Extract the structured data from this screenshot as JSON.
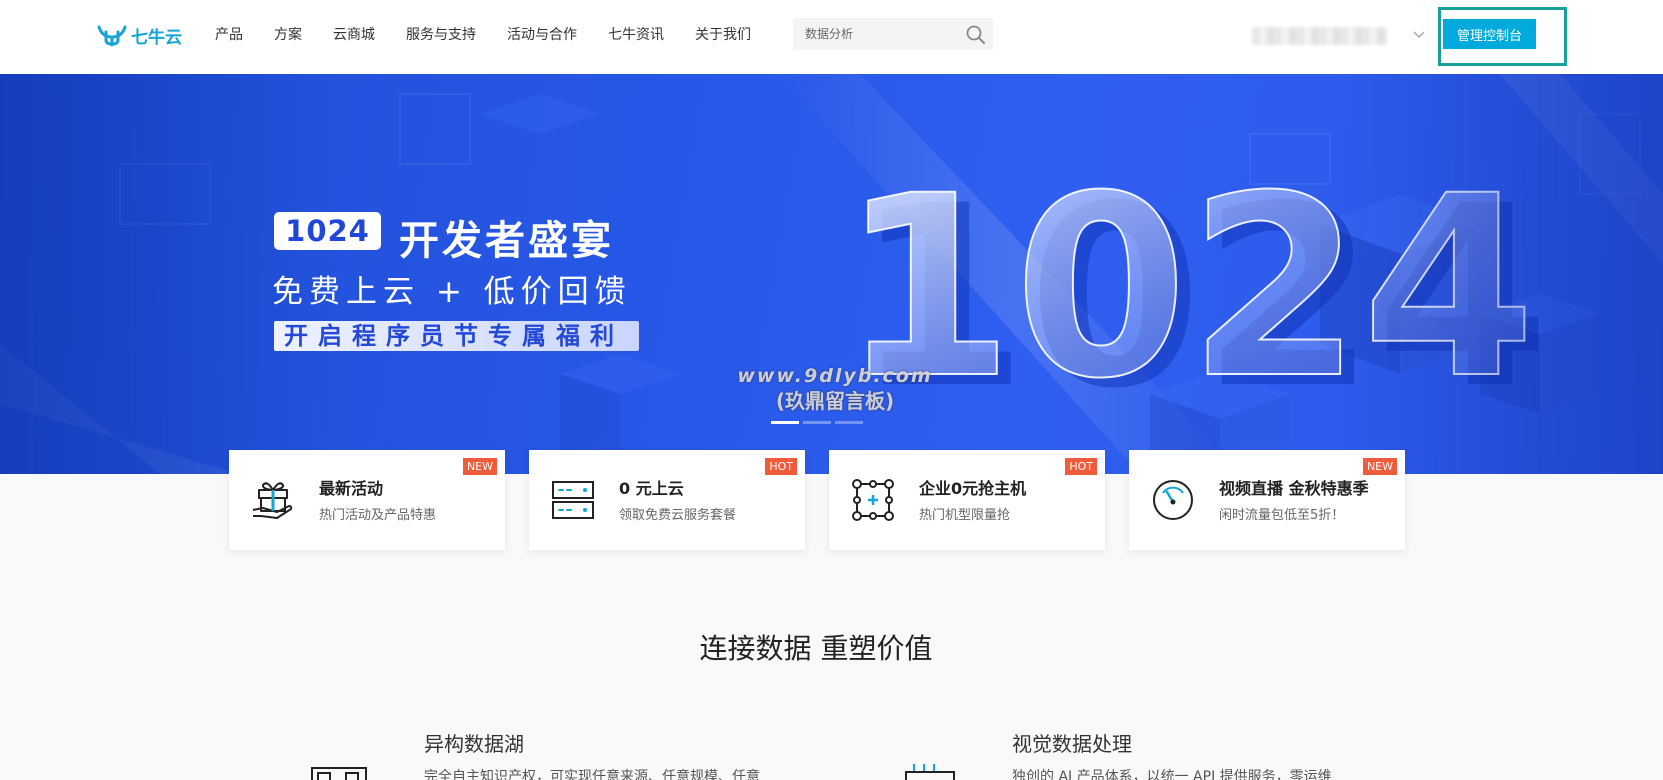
{
  "header": {
    "logo_text": "七牛云",
    "nav": [
      {
        "label": "产品"
      },
      {
        "label": "方案"
      },
      {
        "label": "云商城"
      },
      {
        "label": "服务与支持"
      },
      {
        "label": "活动与合作"
      },
      {
        "label": "七牛资讯"
      },
      {
        "label": "关于我们"
      }
    ],
    "search": {
      "placeholder": "数据分析"
    },
    "console_label": "管理控制台"
  },
  "banner": {
    "tag": "1024",
    "title": "开发者盛宴",
    "subtitle": "免费上云 + 低价回馈",
    "strip": "开启程序员节专属福利",
    "big_number": "1024",
    "watermark_line1": "www.9dlyb.com",
    "watermark_line2": "(玖鼎留言板)",
    "slide_count": 3,
    "active_slide": 1
  },
  "cards": [
    {
      "title": "最新活动",
      "desc": "热门活动及产品特惠",
      "badge": "NEW",
      "icon": "gift-icon"
    },
    {
      "title": "0 元上云",
      "desc": "领取免费云服务套餐",
      "badge": "HOT",
      "icon": "server-icon"
    },
    {
      "title": "企业0元抢主机",
      "desc": "热门机型限量抢",
      "badge": "HOT",
      "icon": "host-node-icon"
    },
    {
      "title": "视频直播 金秋特惠季",
      "desc": "闲时流量包低至5折！",
      "badge": "NEW",
      "icon": "speed-gauge-icon"
    }
  ],
  "section": {
    "title": "连接数据 重塑价值",
    "features": [
      {
        "title": "异构数据湖",
        "desc": "完全自主知识产权，可实现任意来源、任意规模、任意"
      },
      {
        "title": "视觉数据处理",
        "desc": "独创的 AI 产品体系，以统一 API 提供服务，零运维"
      }
    ]
  },
  "colors": {
    "brand": "#14a4d8",
    "console": "#00aadd",
    "badge": "#f05b3c",
    "banner": "#2757e6"
  }
}
